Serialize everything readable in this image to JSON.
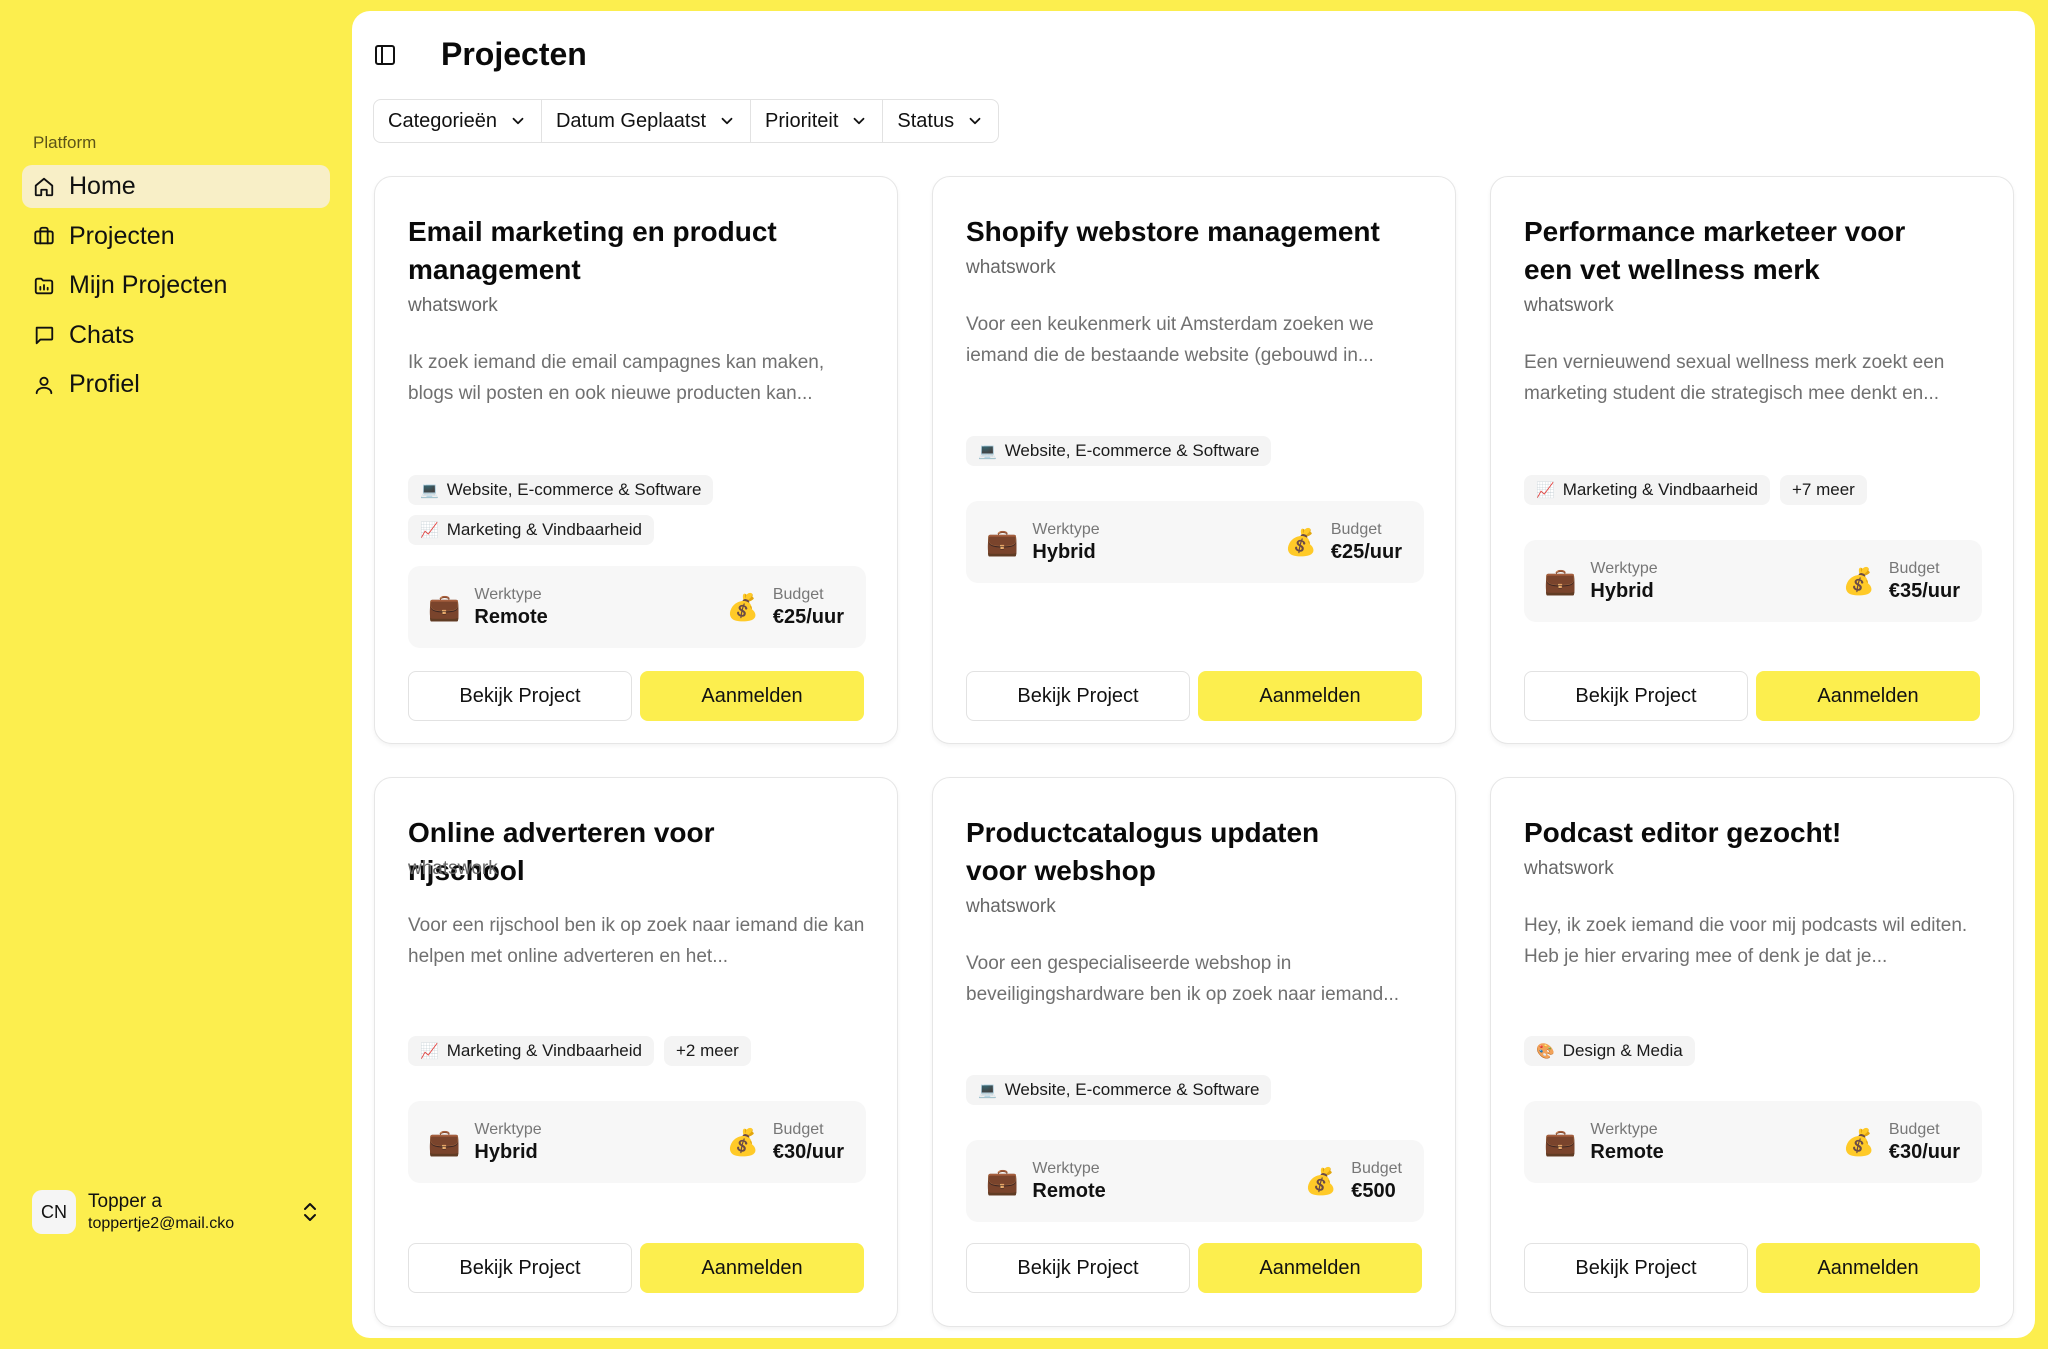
{
  "sidebar": {
    "group_label": "Platform",
    "items": [
      {
        "label": "Home",
        "icon": "home-icon"
      },
      {
        "label": "Projecten",
        "icon": "briefcase-icon"
      },
      {
        "label": "Mijn Projecten",
        "icon": "folder-chart-icon"
      },
      {
        "label": "Chats",
        "icon": "chat-icon"
      },
      {
        "label": "Profiel",
        "icon": "user-icon"
      }
    ],
    "user": {
      "initials": "CN",
      "name": "Topper a",
      "email": "toppertje2@mail.cko"
    }
  },
  "header": {
    "title": "Projecten"
  },
  "filters": [
    "Categorieën",
    "Datum Geplaatst",
    "Prioriteit",
    "Status"
  ],
  "labels": {
    "werktype": "Werktype",
    "budget": "Budget",
    "view_button": "Bekijk Project",
    "apply_button": "Aanmelden"
  },
  "cards": [
    {
      "title": "Email marketing en product management",
      "company": "whatswork",
      "description": "Ik zoek iemand die email campagnes kan maken, blogs wil posten en ook nieuwe producten kan...",
      "tags": [
        {
          "emoji": "💻",
          "label": "Website, E-commerce & Software"
        },
        {
          "emoji": "📈",
          "label": "Marketing & Vindbaarheid"
        }
      ],
      "werktype": "Remote",
      "budget": "€25/uur"
    },
    {
      "title": "Shopify webstore management",
      "company": "whatswork",
      "description": "Voor een keukenmerk uit Amsterdam zoeken we iemand die de bestaande website (gebouwd in...",
      "tags": [
        {
          "emoji": "💻",
          "label": "Website, E-commerce & Software"
        }
      ],
      "werktype": "Hybrid",
      "budget": "€25/uur"
    },
    {
      "title": "Performance marketeer voor een vet wellness merk",
      "company": "whatswork",
      "description": "Een vernieuwend sexual wellness merk zoekt een marketing student die strategisch mee denkt en...",
      "tags": [
        {
          "emoji": "📈",
          "label": "Marketing & Vindbaarheid"
        },
        {
          "emoji": "",
          "label": "+7 meer"
        }
      ],
      "werktype": "Hybrid",
      "budget": "€35/uur"
    },
    {
      "title": "Online adverteren voor rijschool",
      "company": "whatswork",
      "description": "Voor een rijschool ben ik op zoek naar iemand die kan helpen met online adverteren en het...",
      "tags": [
        {
          "emoji": "📈",
          "label": "Marketing & Vindbaarheid"
        },
        {
          "emoji": "",
          "label": "+2 meer"
        }
      ],
      "werktype": "Hybrid",
      "budget": "€30/uur"
    },
    {
      "title": "Productcatalogus updaten voor webshop",
      "company": "whatswork",
      "description": "Voor een gespecialiseerde webshop in beveiligingshardware ben ik op zoek naar iemand...",
      "tags": [
        {
          "emoji": "💻",
          "label": "Website, E-commerce & Software"
        }
      ],
      "werktype": "Remote",
      "budget": "€500"
    },
    {
      "title": "Podcast editor gezocht!",
      "company": "whatswork",
      "description": "Hey, ik zoek iemand die voor mij podcasts wil editen. Heb je hier ervaring mee of denk je dat je...",
      "tags": [
        {
          "emoji": "🎨",
          "label": "Design & Media"
        }
      ],
      "werktype": "Remote",
      "budget": "€30/uur"
    }
  ],
  "icons": {
    "werktype": "💼",
    "budget": "💰"
  },
  "colors": {
    "accent": "#fcee4e",
    "active_nav": "#f8efc7"
  }
}
